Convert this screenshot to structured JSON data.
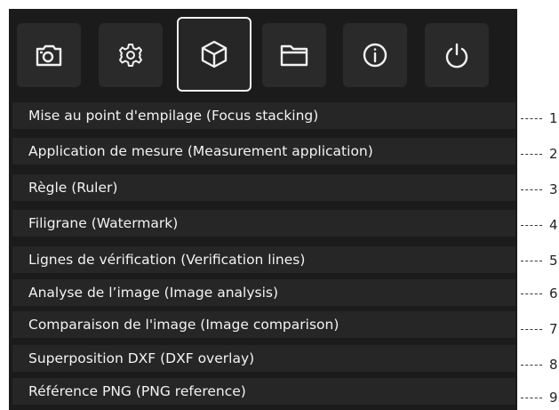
{
  "toolbar": {
    "buttons": [
      {
        "icon": "camera-icon",
        "active": false
      },
      {
        "icon": "gear-icon",
        "active": false
      },
      {
        "icon": "cube-icon",
        "active": true
      },
      {
        "icon": "folder-icon",
        "active": false
      },
      {
        "icon": "info-icon",
        "active": false
      },
      {
        "icon": "power-icon",
        "active": false
      }
    ]
  },
  "menu": {
    "items": [
      {
        "label": "Mise au point d'empilage (Focus stacking)",
        "callout": "1"
      },
      {
        "label": "Application de mesure (Measurement application)",
        "callout": "2"
      },
      {
        "label": "Règle (Ruler)",
        "callout": "3"
      },
      {
        "label": "Filigrane (Watermark)",
        "callout": "4"
      },
      {
        "label": "Lignes de vérification (Verification lines)",
        "callout": "5"
      },
      {
        "label": "Analyse de l’image (Image analysis)",
        "callout": "6"
      },
      {
        "label": "Comparaison de l'image (Image comparison)",
        "callout": "7"
      },
      {
        "label": "Superposition DXF (DXF overlay)",
        "callout": "8"
      },
      {
        "label": "Référence PNG (PNG reference)",
        "callout": "9"
      }
    ]
  },
  "colors": {
    "panel_bg": "#1b1b1b",
    "row_bg": "#262626",
    "button_bg": "#2a2a2a",
    "text": "#f3f3f3",
    "active_border": "#f2f2f2"
  }
}
